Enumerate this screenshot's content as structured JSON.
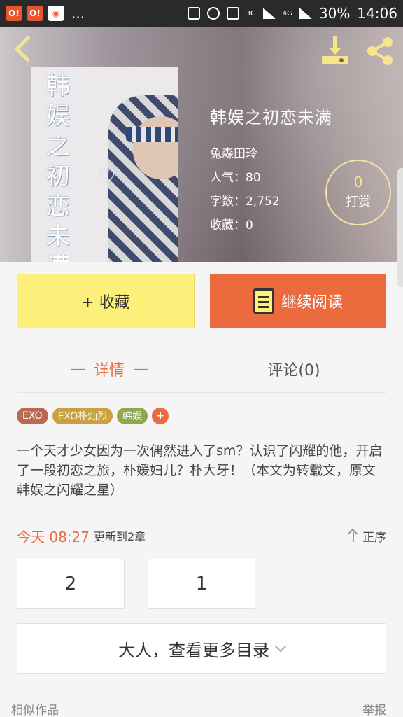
{
  "status_bar": {
    "notif1": "O!",
    "notif2": "O!",
    "notif_more": "...",
    "network_3g": "3G",
    "network_4g": "4G",
    "battery": "30%",
    "time": "14:06"
  },
  "book": {
    "title": "韩娱之初恋未满",
    "author": "兔森田玲",
    "popularity": "人气：80",
    "word_count": "字数：2,752",
    "favorites": "收藏：0",
    "cover_title": [
      "韩",
      "娱",
      "之",
      "初",
      "恋",
      "未",
      "满"
    ],
    "cover_heart": "♡"
  },
  "reward": {
    "count": "0",
    "label": "打赏"
  },
  "actions": {
    "collect": "+ 收藏",
    "read": "继续阅读"
  },
  "tabs": [
    {
      "label": "详情",
      "active": true
    },
    {
      "label": "评论(0)",
      "active": false
    }
  ],
  "tab_dash": "—",
  "tags": [
    {
      "label": "EXO",
      "color": "#b86a52"
    },
    {
      "label": "EXO朴灿烈",
      "color": "#c9a13e"
    },
    {
      "label": "韩娱",
      "color": "#8fa74d"
    },
    {
      "label": "+",
      "color": "#eb6a3e"
    }
  ],
  "description": "一个天才少女因为一次偶然进入了sm？认识了闪耀的他，开启了一段初恋之旅，朴媛妇儿？朴大牙！（本文为转载文，原文韩娱之闪耀之星）",
  "update": {
    "time": "今天 08:27",
    "text": "更新到2章",
    "order_label": "正序"
  },
  "chapters": [
    "2",
    "1"
  ],
  "more_toc": "大人，查看更多目录",
  "footer": {
    "similar": "相似作品",
    "report": "举报"
  },
  "colors": {
    "accent": "#eb6a3e",
    "collect_bg": "#fdf07a"
  }
}
